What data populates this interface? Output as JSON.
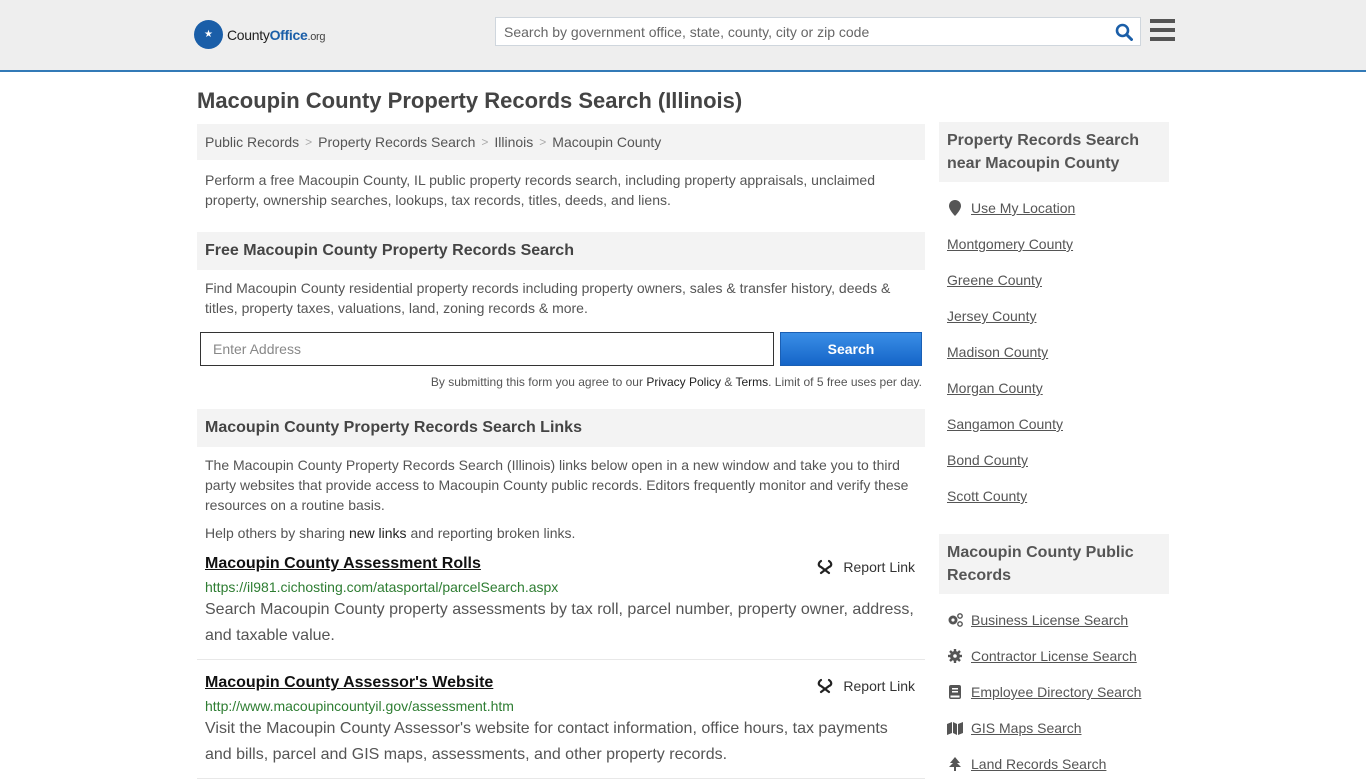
{
  "header": {
    "logo": {
      "name_part1": "County",
      "name_part2": "Office",
      "tld": ".org"
    },
    "search_placeholder": "Search by government office, state, county, city or zip code",
    "accent_color": "#337ab7"
  },
  "page_title": "Macoupin County Property Records Search (Illinois)",
  "breadcrumb": [
    {
      "label": "Public Records"
    },
    {
      "label": "Property Records Search"
    },
    {
      "label": "Illinois"
    },
    {
      "label": "Macoupin County"
    }
  ],
  "intro": "Perform a free Macoupin County, IL public property records search, including property appraisals, unclaimed property, ownership searches, lookups, tax records, titles, deeds, and liens.",
  "free_search": {
    "heading": "Free Macoupin County Property Records Search",
    "description": "Find Macoupin County residential property records including property owners, sales & transfer history, deeds & titles, property taxes, valuations, land, zoning records & more.",
    "address_placeholder": "Enter Address",
    "button_label": "Search",
    "disclaimer_prefix": "By submitting this form you agree to our ",
    "privacy_label": "Privacy Policy",
    "amp": " & ",
    "terms_label": "Terms",
    "disclaimer_suffix": ". Limit of 5 free uses per day."
  },
  "links_section": {
    "heading": "Macoupin County Property Records Search Links",
    "description": "The Macoupin County Property Records Search (Illinois) links below open in a new window and take you to third party websites that provide access to Macoupin County public records. Editors frequently monitor and verify these resources on a routine basis.",
    "help_prefix": "Help others by sharing ",
    "help_link": "new links",
    "help_suffix": " and reporting broken links.",
    "report_label": "Report Link",
    "items": [
      {
        "title": "Macoupin County Assessment Rolls",
        "url": "https://il981.cichosting.com/atasportal/parcelSearch.aspx",
        "description": "Search Macoupin County property assessments by tax roll, parcel number, property owner, address, and taxable value."
      },
      {
        "title": "Macoupin County Assessor's Website",
        "url": "http://www.macoupincountyil.gov/assessment.htm",
        "description": "Visit the Macoupin County Assessor's website for contact information, office hours, tax payments and bills, parcel and GIS maps, assessments, and other property records."
      }
    ]
  },
  "sidebar": {
    "nearby": {
      "heading": "Property Records Search near Macoupin County",
      "use_location": "Use My Location",
      "counties": [
        "Montgomery County",
        "Greene County",
        "Jersey County",
        "Madison County",
        "Morgan County",
        "Sangamon County",
        "Bond County",
        "Scott County"
      ]
    },
    "public_records": {
      "heading": "Macoupin County Public Records",
      "items": [
        {
          "label": "Business License Search",
          "icon": "cogs-icon"
        },
        {
          "label": "Contractor License Search",
          "icon": "gear-icon"
        },
        {
          "label": "Employee Directory Search",
          "icon": "book-icon"
        },
        {
          "label": "GIS Maps Search",
          "icon": "map-icon"
        },
        {
          "label": "Land Records Search",
          "icon": "tree-icon"
        }
      ]
    }
  }
}
